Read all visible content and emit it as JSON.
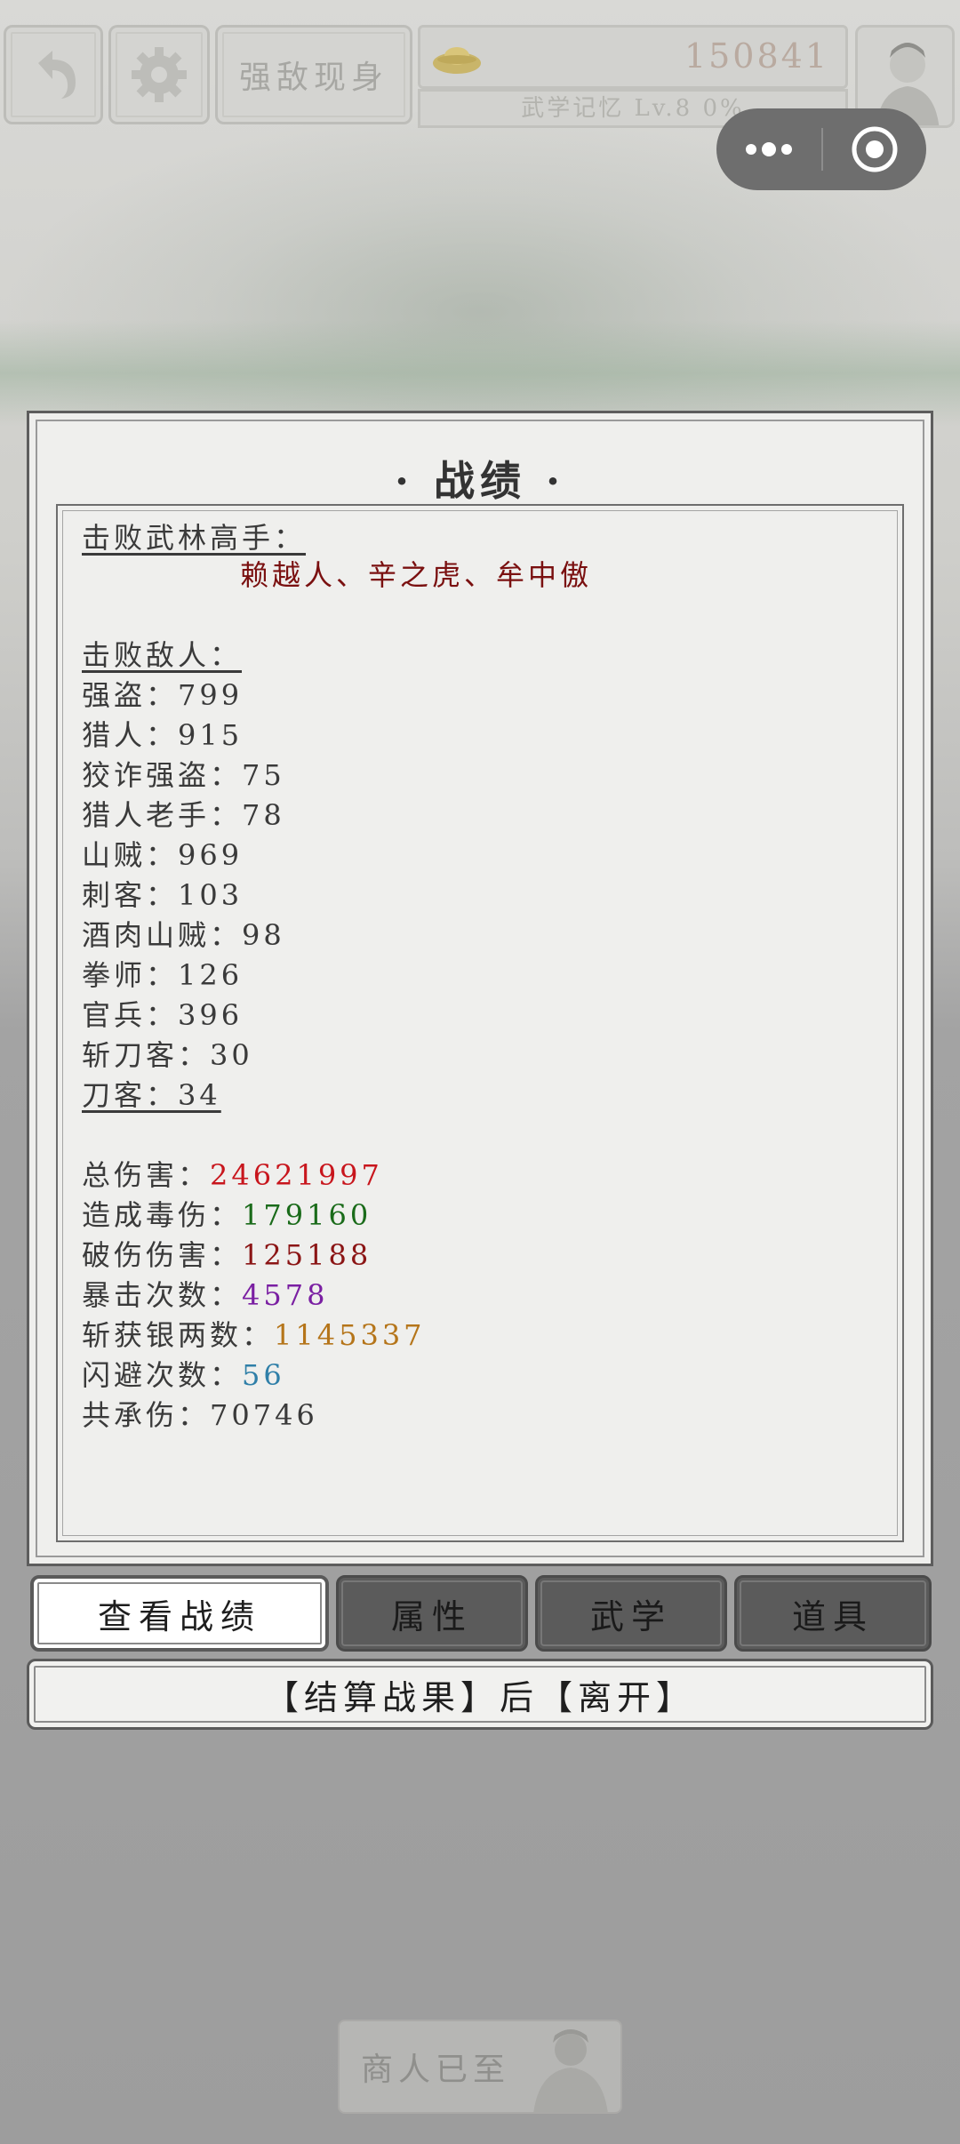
{
  "header": {
    "event_title": "强敌现身",
    "silver": "150841",
    "level_text": "武学记忆 Lv.8 0%",
    "icons": [
      "back-arrow-icon",
      "gear-icon",
      "gold-ingot-icon",
      "avatar-portrait",
      "more-dots-icon",
      "record-circle-icon"
    ]
  },
  "panel": {
    "title": "· 战绩 ·",
    "masters_label": "击败武林高手：",
    "masters": "赖越人、辛之虎、牟中傲",
    "enemies_label": "击败敌人：",
    "enemies": [
      {
        "text": "强盗：799"
      },
      {
        "text": "猎人：915"
      },
      {
        "text": "狡诈强盗：75"
      },
      {
        "text": "猎人老手：78"
      },
      {
        "text": "山贼：969"
      },
      {
        "text": "刺客：103"
      },
      {
        "text": "酒肉山贼：98"
      },
      {
        "text": "拳师：126"
      },
      {
        "text": "官兵：396"
      },
      {
        "text": "斩刀客：30"
      },
      {
        "text": "刀客：34"
      }
    ],
    "stats": [
      {
        "label": "总伤害：",
        "value": "24621997",
        "color": "#c8161d"
      },
      {
        "label": "造成毒伤：",
        "value": "179160",
        "color": "#1a6b1a"
      },
      {
        "label": "破伤伤害：",
        "value": "125188",
        "color": "#8b1515"
      },
      {
        "label": "暴击次数：",
        "value": "4578",
        "color": "#7a1fa2"
      },
      {
        "label": "斩获银两数：",
        "value": "1145337",
        "color": "#b5751a"
      },
      {
        "label": "闪避次数：",
        "value": "56",
        "color": "#2f7fa8"
      },
      {
        "label": "共承伤：",
        "value": "70746",
        "color": "#3a3a3a"
      }
    ]
  },
  "tabs": [
    {
      "label": "查看战绩",
      "active": true
    },
    {
      "label": "属性",
      "active": false
    },
    {
      "label": "武学",
      "active": false
    },
    {
      "label": "道具",
      "active": false
    }
  ],
  "settle_button": "【结算战果】后【离开】",
  "merchant": "商人已至"
}
